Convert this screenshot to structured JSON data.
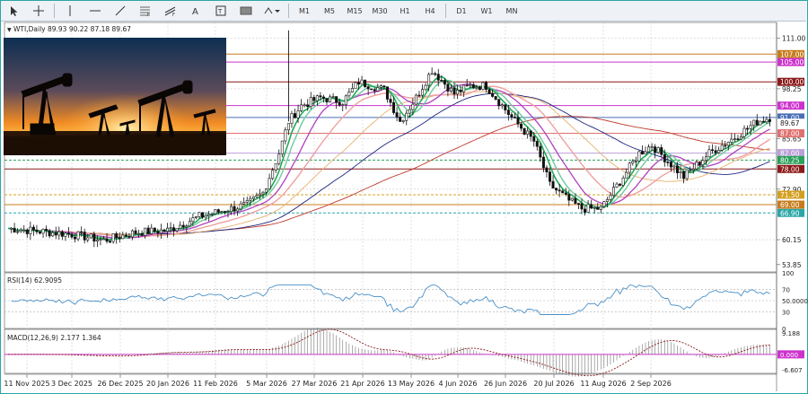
{
  "toolbar": {
    "tools": [
      "cursor-icon",
      "crosshair-icon",
      "vertical-line-icon",
      "horizontal-line-icon",
      "trendline-icon",
      "fibonacci-icon",
      "channel-icon",
      "text-icon",
      "label-icon",
      "rectangle-icon",
      "draw-settings-icon"
    ],
    "timeframes": [
      "M1",
      "M5",
      "M15",
      "M30",
      "H1",
      "H4",
      "D1",
      "W1",
      "MN"
    ]
  },
  "main_panel": {
    "title": "WTI,Daily  89.93 90.22 87.18 89.67",
    "price_axis": [
      "111.00",
      "98.25",
      "85.65",
      "72.90",
      "60.15",
      "53.85"
    ],
    "level_labels": [
      {
        "text": "107.00",
        "color": "#c87c1c"
      },
      {
        "text": "105.00",
        "color": "#cc33cc"
      },
      {
        "text": "100.00",
        "color": "#8b1a1a"
      },
      {
        "text": "94.00",
        "color": "#cc33cc"
      },
      {
        "text": "91.00",
        "color": "#4a6fb5"
      },
      {
        "text": "89.67",
        "color": "#222222"
      },
      {
        "text": "87.00",
        "color": "#e07070"
      },
      {
        "text": "82.00",
        "color": "#b9a0d8"
      },
      {
        "text": "80.25",
        "color": "#2aa05a"
      },
      {
        "text": "78.00",
        "color": "#8b1a1a"
      },
      {
        "text": "71.50",
        "color": "#d4a020"
      },
      {
        "text": "69.00",
        "color": "#c87c1c"
      },
      {
        "text": "66.90",
        "color": "#2aa6a6"
      }
    ]
  },
  "rsi_panel": {
    "title": "RSI(14) 62.9095",
    "axis": [
      "100",
      "70",
      "50.0000",
      "30",
      "0"
    ]
  },
  "macd_panel": {
    "title": "MACD(12,26,9) 2.177 1.364",
    "axis": [
      "9.188",
      "0.000",
      "-6.607"
    ]
  },
  "date_axis": [
    "11 Nov 2025",
    "3 Dec 2025",
    "26 Dec 2025",
    "20 Jan 2026",
    "11 Feb 2026",
    "5 Mar 2026",
    "27 Mar 2026",
    "21 Apr 2026",
    "13 May 2026",
    "4 Jun 2026",
    "26 Jun 2026",
    "20 Jul 2026",
    "11 Aug 2026",
    "2 Sep 2026"
  ],
  "colors": {
    "accent": "#2aa6a6",
    "candle": "#111111",
    "ma_green": "#22aa55",
    "ma_purple": "#b040c0",
    "ma_navy": "#1a237e",
    "ma_red": "#c0392b",
    "rsi": "#4a90c8",
    "macd": "#8b1a1a"
  }
}
